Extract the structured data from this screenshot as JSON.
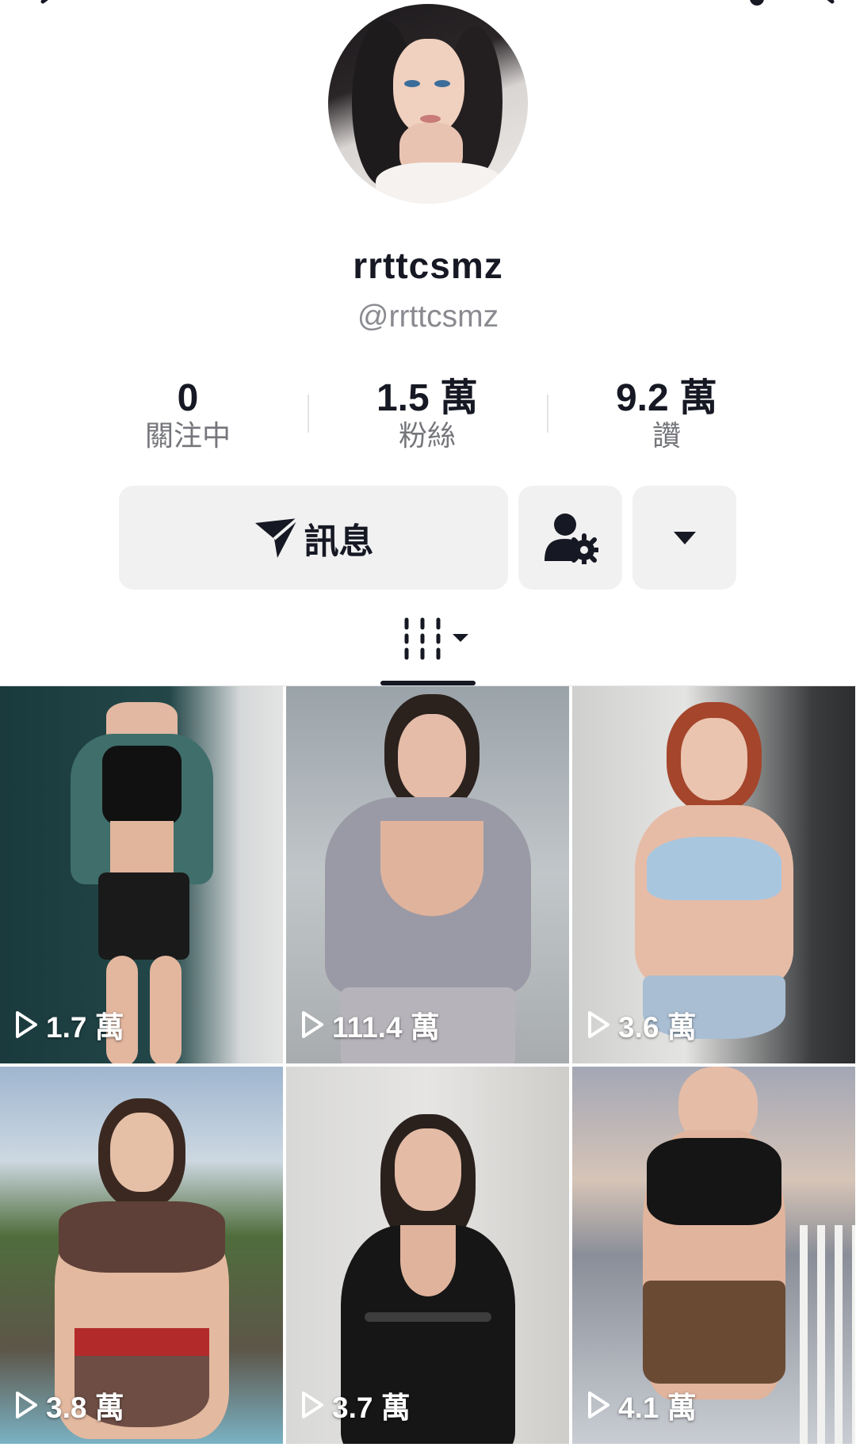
{
  "profile": {
    "display_name": "rrttcsmz",
    "handle": "@rrttcsmz"
  },
  "stats": [
    {
      "value": "0",
      "label": "關注中"
    },
    {
      "value": "1.5 萬",
      "label": "粉絲"
    },
    {
      "value": "9.2 萬",
      "label": "讚"
    }
  ],
  "actions": {
    "message_label": "訊息",
    "icons": {
      "message": "send-icon",
      "user_settings": "user-gear-icon",
      "more": "caret-down-icon"
    }
  },
  "tabs": {
    "active_icon": "video-grid-icon"
  },
  "videos": [
    {
      "views": "1.7 萬"
    },
    {
      "views": "111.4 萬"
    },
    {
      "views": "3.6 萬"
    },
    {
      "views": "3.8 萬"
    },
    {
      "views": "3.7 萬"
    },
    {
      "views": "4.1 萬"
    }
  ],
  "colors": {
    "text": "#161823",
    "secondary": "#8a8b91",
    "button_bg": "#f1f1f2"
  }
}
